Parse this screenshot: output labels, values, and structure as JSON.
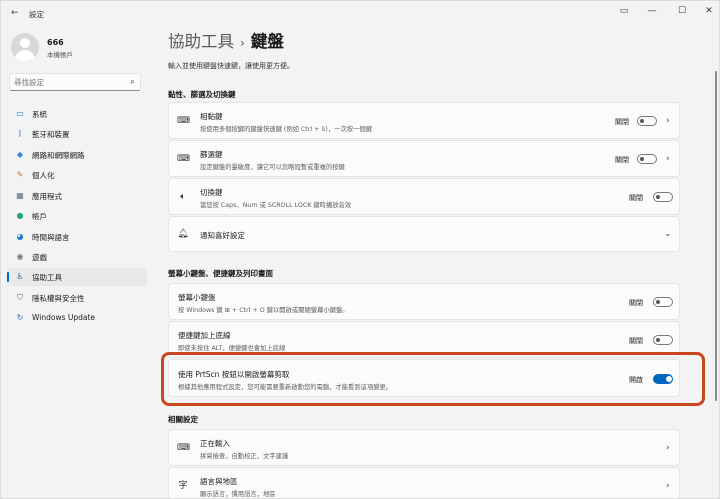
{
  "app": {
    "title": "設定"
  },
  "user": {
    "name": "666",
    "type": "本機帳戶"
  },
  "search": {
    "placeholder": "尋找設定"
  },
  "sidebar": {
    "items": [
      {
        "label": "系統",
        "icon": "system-icon",
        "glyph": "▭",
        "color": "#0a74d6"
      },
      {
        "label": "藍牙和裝置",
        "icon": "bluetooth-icon",
        "glyph": "ᛒ",
        "color": "#1a6fd1"
      },
      {
        "label": "網路和網際網路",
        "icon": "network-icon",
        "glyph": "◆",
        "color": "#2b88d8"
      },
      {
        "label": "個人化",
        "icon": "personalization-icon",
        "glyph": "✎",
        "color": "#c87833"
      },
      {
        "label": "應用程式",
        "icon": "apps-icon",
        "glyph": "▦",
        "color": "#5b6b80"
      },
      {
        "label": "帳戶",
        "icon": "accounts-icon",
        "glyph": "●",
        "color": "#2ba66a"
      },
      {
        "label": "時間與語言",
        "icon": "time-language-icon",
        "glyph": "◕",
        "color": "#1c7fd6"
      },
      {
        "label": "遊戲",
        "icon": "gaming-icon",
        "glyph": "◉",
        "color": "#777777"
      },
      {
        "label": "協助工具",
        "icon": "accessibility-icon",
        "glyph": "♿",
        "color": "#1a5fb4",
        "active": true
      },
      {
        "label": "隱私權與安全性",
        "icon": "privacy-shield-icon",
        "glyph": "⛉",
        "color": "#666666"
      },
      {
        "label": "Windows Update",
        "icon": "windows-update-icon",
        "glyph": "↻",
        "color": "#1470cc"
      }
    ]
  },
  "header": {
    "parent": "協助工具",
    "separator": "›",
    "current": "鍵盤",
    "description": "輸入並使用鍵盤快速鍵，讓使用更方便。"
  },
  "sections": {
    "sticky": "黏性、篩選及切換鍵",
    "onscreen": "螢幕小鍵盤、便捷鍵及列印畫面",
    "related": "相關設定"
  },
  "settings": {
    "sticky_keys": {
      "title": "相黏鍵",
      "desc": "按使用多個按鍵的鍵盤快速鍵 (例如 Ctrl + S)，一次按一個鍵",
      "state": "關閉"
    },
    "filter_keys": {
      "title": "篩選鍵",
      "desc": "設定鍵盤的靈敏度，讓它可以忽略短暫或重複的按鍵",
      "state": "關閉"
    },
    "toggle_keys": {
      "title": "切換鍵",
      "desc": "當您按 Caps、Num 或 SCROLL LOCK 鍵時播放音效",
      "state": "關閉"
    },
    "notification": {
      "title": "通知喜好設定"
    },
    "onscreen_keyboard": {
      "title": "螢幕小鍵盤",
      "desc": "按 Windows 鍵 ⊞ + Ctrl + O 鍵以開啟或關閉螢幕小鍵盤。",
      "state": "關閉"
    },
    "access_keys": {
      "title": "便捷鍵加上底線",
      "desc": "即使未按住 ALT，便捷鍵也會加上底線",
      "state": "關閉"
    },
    "prtscn": {
      "title": "使用 PrtScn 按鈕以開啟螢幕剪取",
      "desc": "根據其他應用程式設定，您可能需要重新啟動您的電腦，才能看到這項變更。",
      "state": "開啟"
    },
    "typing": {
      "title": "正在輸入",
      "desc": "拼寫檢查，自動校正，文字建議"
    },
    "language_region": {
      "title": "語言與地區",
      "desc": "顯示語言，慣用語言，地區"
    }
  },
  "colors": {
    "accent": "#0067c0",
    "highlight": "#c9461e"
  }
}
